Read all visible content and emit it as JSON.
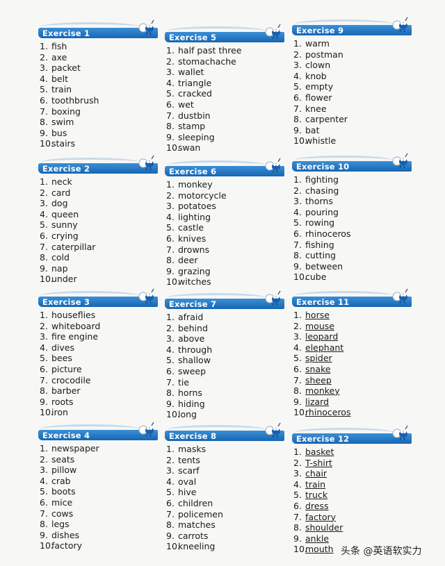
{
  "columns": [
    [
      {
        "title": "Exercise 1",
        "items": [
          "fish",
          "axe",
          "packet",
          "belt",
          "train",
          "toothbrush",
          "boxing",
          "swim",
          "bus",
          "stairs"
        ]
      },
      {
        "title": "Exercise 2",
        "items": [
          "neck",
          "card",
          "dog",
          "queen",
          "sunny",
          "crying",
          "caterpillar",
          "cold",
          "nap",
          "under"
        ]
      },
      {
        "title": "Exercise 3",
        "items": [
          "houseflies",
          "whiteboard",
          "fire engine",
          "dives",
          "bees",
          "picture",
          "crocodile",
          "barber",
          "roots",
          "iron"
        ]
      },
      {
        "title": "Exercise 4",
        "items": [
          "newspaper",
          "seats",
          "pillow",
          "crab",
          "boots",
          "mice",
          "cows",
          "legs",
          "dishes",
          "factory"
        ]
      }
    ],
    [
      {
        "title": "Exercise 5",
        "items": [
          "half past three",
          "stomachache",
          "wallet",
          "triangle",
          "cracked",
          "wet",
          "dustbin",
          "stamp",
          "sleeping",
          "swan"
        ]
      },
      {
        "title": "Exercise 6",
        "items": [
          "monkey",
          "motorcycle",
          "potatoes",
          "lighting",
          "castle",
          "knives",
          "drowns",
          "deer",
          "grazing",
          "witches"
        ]
      },
      {
        "title": "Exercise 7",
        "items": [
          "afraid",
          "behind",
          "above",
          "through",
          "shallow",
          "sweep",
          "tie",
          "horns",
          "hiding",
          "long"
        ]
      },
      {
        "title": "Exercise 8",
        "items": [
          "masks",
          "tents",
          "scarf",
          "oval",
          "hive",
          "children",
          "policemen",
          "matches",
          "carrots",
          "kneeling"
        ]
      }
    ],
    [
      {
        "title": "Exercise 9",
        "items": [
          "warm",
          "postman",
          "clown",
          "knob",
          "empty",
          "flower",
          "knee",
          "carpenter",
          "bat",
          "whistle"
        ]
      },
      {
        "title": "Exercise 10",
        "items": [
          "fighting",
          "chasing",
          "thorns",
          "pouring",
          "rowing",
          "rhinoceros",
          "fishing",
          "cutting",
          "between",
          "cube"
        ]
      },
      {
        "title": "Exercise 11",
        "items": [
          "horse",
          "mouse",
          "leopard",
          "elephant",
          "spider",
          "snake",
          "sheep",
          "monkey",
          "lizard",
          "rhinoceros"
        ]
      },
      {
        "title": "Exercise 12",
        "items": [
          "basket",
          "T-shirt",
          "chair",
          "train",
          "truck",
          "dress",
          "factory",
          "shoulder",
          "ankle",
          "mouth"
        ]
      }
    ]
  ],
  "numbers": [
    "1.",
    "2.",
    "3.",
    "4.",
    "5.",
    "6.",
    "7.",
    "8.",
    "9.",
    "10."
  ],
  "watermark": "头条 @英语软实力",
  "colors": {
    "header": "#1f74c2",
    "header_text": "#ffffff"
  }
}
